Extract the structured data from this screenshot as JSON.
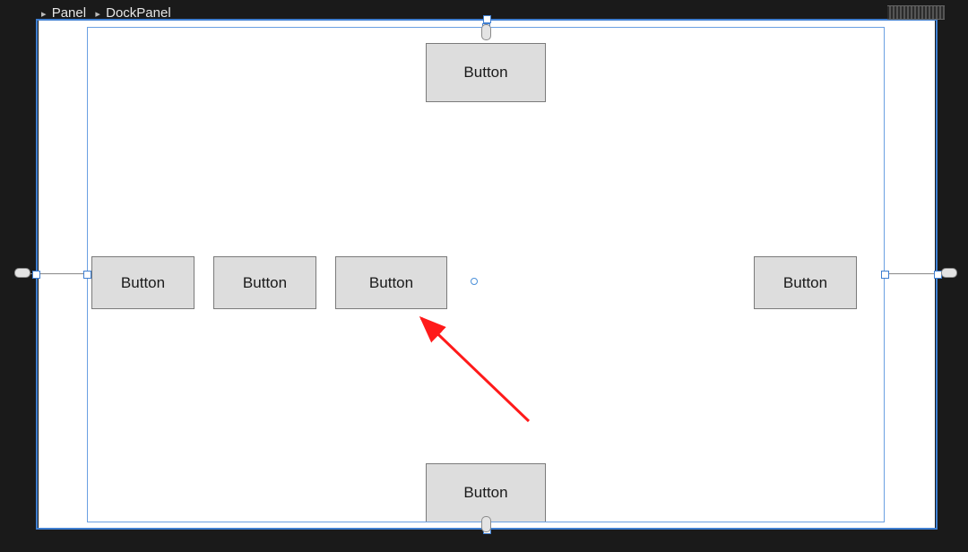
{
  "breadcrumb": {
    "panel": "Panel",
    "dockpanel": "DockPanel"
  },
  "buttons": {
    "top": {
      "label": "Button"
    },
    "bottom": {
      "label": "Button"
    },
    "left1": {
      "label": "Button"
    },
    "left2": {
      "label": "Button"
    },
    "center": {
      "label": "Button"
    },
    "right": {
      "label": "Button"
    }
  },
  "colors": {
    "selection": "#3f7fd1",
    "button_bg": "#dddddd",
    "annotation": "#ff1a1a"
  }
}
